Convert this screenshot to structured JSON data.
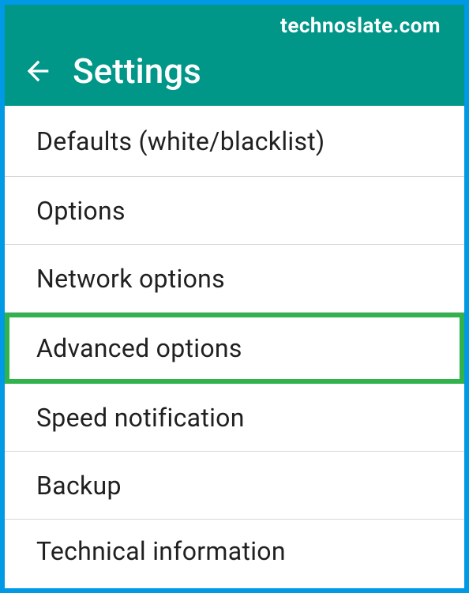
{
  "watermark": "technoslate.com",
  "header": {
    "title": "Settings"
  },
  "menu": {
    "items": [
      {
        "label": "Defaults (white/blacklist)",
        "highlighted": false
      },
      {
        "label": "Options",
        "highlighted": false
      },
      {
        "label": "Network options",
        "highlighted": false
      },
      {
        "label": "Advanced options",
        "highlighted": true
      },
      {
        "label": "Speed notification",
        "highlighted": false
      },
      {
        "label": "Backup",
        "highlighted": false
      },
      {
        "label": "Technical information",
        "highlighted": false
      }
    ]
  }
}
